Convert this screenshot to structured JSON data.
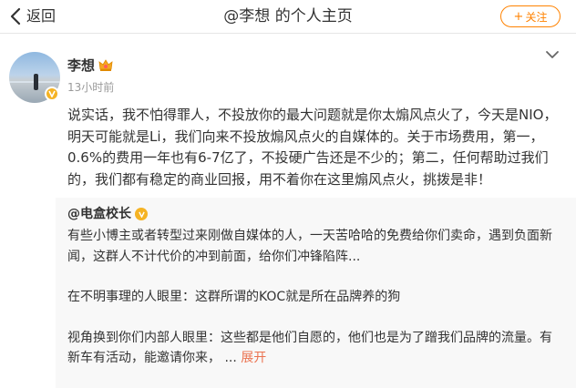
{
  "navbar": {
    "back_label": "返回",
    "title": "@李想 的个人主页",
    "follow_label": "关注",
    "follow_plus": "+"
  },
  "post": {
    "author": "李想",
    "time": "13小时前",
    "body": "说实话，我不怕得罪人，不投放你的最大问题就是你太煽风点火了，今天是NIO，明天可能就是Li，我们向来不投放煽风点火的自媒体的。关于市场费用，第一，0.6%的费用一年也有6-7亿了，不投硬广告还是不少的；第二，任何帮助过我们的，我们都有稳定的商业回报，用不着你在这里煽风点火，挑拨是非！"
  },
  "repost": {
    "author": "@电盒校长",
    "paragraph1": "有些小博主或者转型过来刚做自媒体的人，一天苦哈哈的免费给你们卖命，遇到负面新闻，这群人不计代价的冲到前面，给你们冲锋陷阵...",
    "paragraph2": "在不明事理的人眼里：这群所谓的KOC就是所在品牌养的狗",
    "paragraph3": "视角换到你们内部人眼里：这些都是他们自愿的，他们也是为了蹭我们品牌的流量。有新车有活动，能邀请你来，",
    "ellipsis": " ... ",
    "more_label": "展开"
  },
  "colors": {
    "accent": "#ff8200",
    "link": "#eb7350",
    "verified": "#f5b324",
    "repost_bg": "#f8f8f8"
  },
  "icons": {
    "back": "chevron-left-icon",
    "menu": "chevron-down-icon",
    "verified": "verified-badge-icon",
    "member": "crown-icon"
  }
}
